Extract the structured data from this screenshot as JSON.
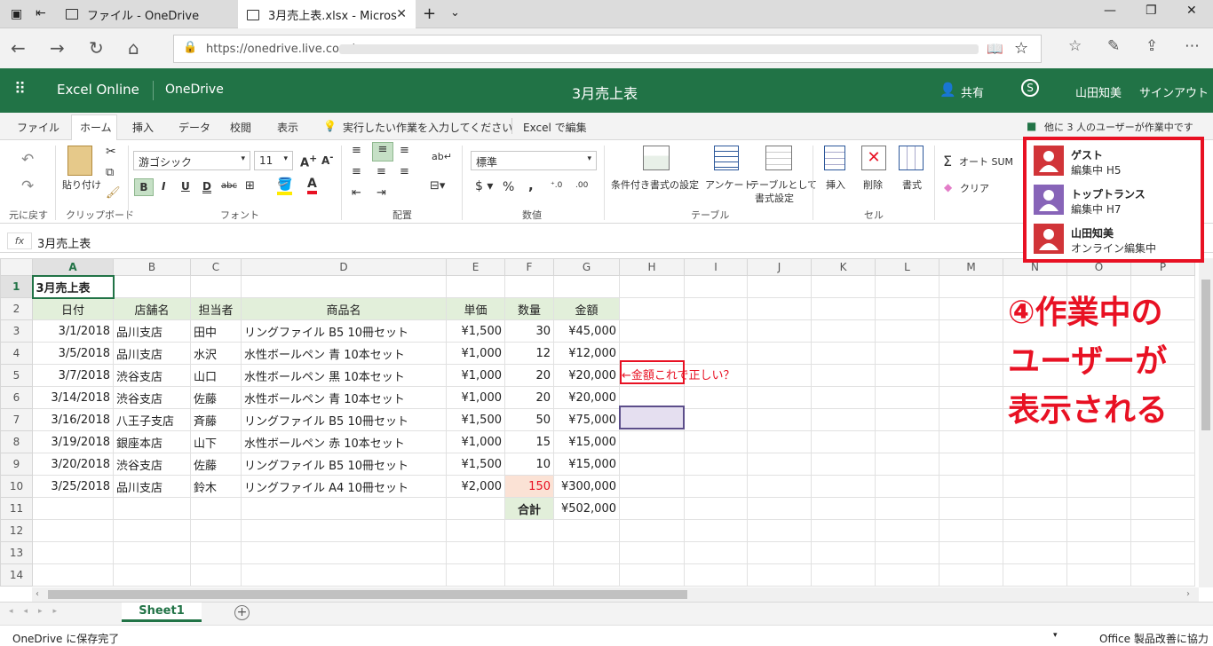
{
  "browser": {
    "tabs": [
      "ファイル - OneDrive",
      "3月売上表.xlsx - Micros"
    ],
    "url": "https://onedrive.live.com/"
  },
  "app": {
    "name": "Excel Online",
    "service": "OneDrive",
    "doc_title": "3月売上表",
    "share": "共有",
    "user": "山田知美",
    "signout": "サインアウト"
  },
  "ribbon_tabs": [
    "ファイル",
    "ホーム",
    "挿入",
    "データ",
    "校閲",
    "表示"
  ],
  "tell_me": "実行したい作業を入力してください",
  "edit_in_excel": "Excel で編集",
  "presence": "他に 3 人のユーザーが作業中です",
  "ribbon": {
    "font_name": "游ゴシック",
    "font_size": "11",
    "number_format": "標準",
    "paste": "貼り付け",
    "cond_format": "条件付き書式の設定",
    "survey": "アンケート",
    "format_table": "テーブルとして",
    "format_table2": "書式設定",
    "insert": "挿入",
    "delete": "削除",
    "format": "書式",
    "autosum": "オート SUM",
    "clear": "クリア",
    "groups": [
      "元に戻す",
      "クリップボード",
      "フォント",
      "配置",
      "数値",
      "テーブル",
      "セル"
    ]
  },
  "formula_bar": {
    "fx": "fx",
    "value": "3月売上表"
  },
  "columns": [
    "A",
    "B",
    "C",
    "D",
    "E",
    "F",
    "G",
    "H",
    "I",
    "J",
    "K",
    "L",
    "M",
    "N",
    "O",
    "P"
  ],
  "rows": [
    [
      "3月売上表",
      "",
      "",
      "",
      "",
      "",
      ""
    ],
    [
      "日付",
      "店舗名",
      "担当者",
      "商品名",
      "単価",
      "数量",
      "金額"
    ],
    [
      "3/1/2018",
      "品川支店",
      "田中",
      "リングファイル B5 10冊セット",
      "¥1,500",
      "30",
      "¥45,000"
    ],
    [
      "3/5/2018",
      "品川支店",
      "水沢",
      "水性ボールペン 青 10本セット",
      "¥1,000",
      "12",
      "¥12,000"
    ],
    [
      "3/7/2018",
      "渋谷支店",
      "山口",
      "水性ボールペン 黒 10本セット",
      "¥1,000",
      "20",
      "¥20,000"
    ],
    [
      "3/14/2018",
      "渋谷支店",
      "佐藤",
      "水性ボールペン 青 10本セット",
      "¥1,000",
      "20",
      "¥20,000"
    ],
    [
      "3/16/2018",
      "八王子支店",
      "斉藤",
      "リングファイル B5 10冊セット",
      "¥1,500",
      "50",
      "¥75,000"
    ],
    [
      "3/19/2018",
      "銀座本店",
      "山下",
      "水性ボールペン 赤 10本セット",
      "¥1,000",
      "15",
      "¥15,000"
    ],
    [
      "3/20/2018",
      "渋谷支店",
      "佐藤",
      "リングファイル B5 10冊セット",
      "¥1,500",
      "10",
      "¥15,000"
    ],
    [
      "3/25/2018",
      "品川支店",
      "鈴木",
      "リングファイル A4 10冊セット",
      "¥2,000",
      "150",
      "¥300,000"
    ],
    [
      "",
      "",
      "",
      "",
      "",
      "合計",
      "¥502,000"
    ],
    [
      "",
      "",
      "",
      "",
      "",
      "",
      ""
    ],
    [
      "",
      "",
      "",
      "",
      "",
      "",
      ""
    ],
    [
      "",
      "",
      "",
      "",
      "",
      "",
      ""
    ]
  ],
  "comment_h5": "←金額これで正しい？",
  "sheet_tab": "Sheet1",
  "status": "OneDrive に保存完了",
  "status_right": "Office 製品改善に協力",
  "users": [
    {
      "name": "ゲスト",
      "status": "編集中 H5",
      "color": "#d13438"
    },
    {
      "name": "トップトランス",
      "status": "編集中 H7",
      "color": "#8764b8"
    },
    {
      "name": "山田知美",
      "status": "オンライン編集中",
      "color": "#d13438"
    }
  ],
  "annotation": [
    "④作業中の",
    "ユーザーが",
    "表示される"
  ]
}
